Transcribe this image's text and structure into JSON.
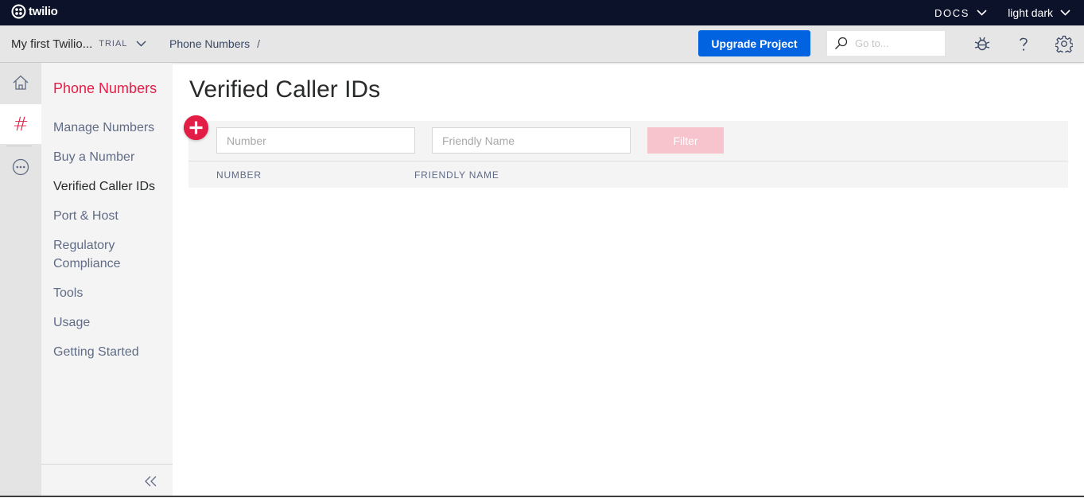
{
  "topbar": {
    "logo_text": "twilio",
    "docs_label": "DOCS",
    "theme_label": "light dark",
    "bg_color": "#0d122b"
  },
  "projectbar": {
    "project_name": "My first Twilio...",
    "plan_badge": "TRIAL",
    "breadcrumb": "Phone Numbers",
    "breadcrumb_separator": "/",
    "upgrade_label": "Upgrade Project",
    "goto_placeholder": "Go to...",
    "icons": [
      "bug-icon",
      "help-icon",
      "gear-icon"
    ]
  },
  "rail": {
    "items": [
      "home-icon",
      "phone-numbers-hash-icon",
      "more-icon"
    ],
    "hash_glyph": "#"
  },
  "sidebar": {
    "title": "Phone Numbers",
    "items": [
      {
        "label": "Manage Numbers"
      },
      {
        "label": "Buy a Number"
      },
      {
        "label": "Verified Caller IDs",
        "active": true
      },
      {
        "label": "Port & Host"
      },
      {
        "label": "Regulatory Compliance"
      },
      {
        "label": "Tools"
      },
      {
        "label": "Usage"
      },
      {
        "label": "Getting Started"
      }
    ]
  },
  "main": {
    "title": "Verified Caller IDs",
    "filter": {
      "number_placeholder": "Number",
      "friendly_name_placeholder": "Friendly Name",
      "filter_label": "Filter"
    },
    "table": {
      "columns": [
        "NUMBER",
        "FRIENDLY NAME"
      ],
      "rows": []
    }
  },
  "colors": {
    "accent_red": "#e31e46",
    "primary_blue": "#0263e0",
    "disabled_filter": "#f7c3cc"
  }
}
